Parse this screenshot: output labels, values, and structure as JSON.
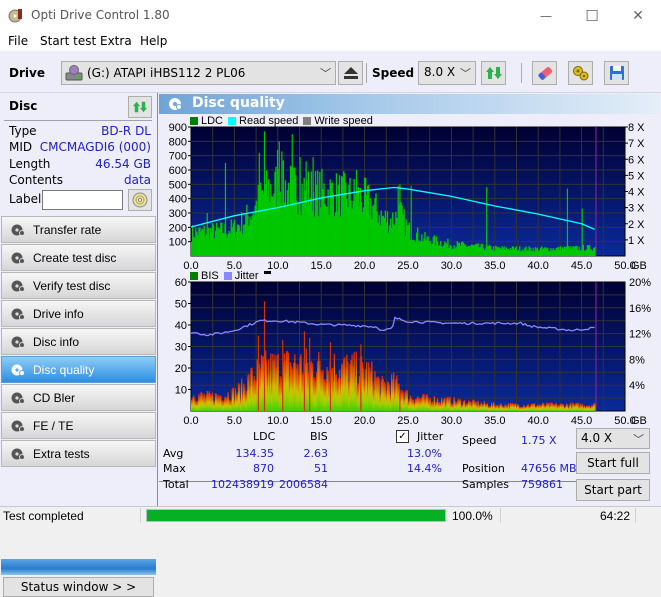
{
  "window": {
    "title": "Opti Drive Control 1.80",
    "controls": {
      "minimize": "—",
      "maximize": "☐",
      "close": "✕"
    }
  },
  "menu": [
    "File",
    "Start test",
    "Extra",
    "Help"
  ],
  "toolbar": {
    "drive_label": "Drive",
    "drive_value": "(G:)  ATAPI iHBS112   2 PL06",
    "speed_label": "Speed",
    "speed_value": "8.0 X",
    "icons": [
      "eject-icon",
      "refresh-icon",
      "erase-icon",
      "settings-icon",
      "save-icon"
    ]
  },
  "disc": {
    "header": "Disc",
    "rows": [
      {
        "label": "Type",
        "value": "BD-R DL"
      },
      {
        "label": "MID",
        "value": "CMCMAGDI6 (000)"
      },
      {
        "label": "Length",
        "value": "46.54 GB"
      },
      {
        "label": "Contents",
        "value": "data"
      }
    ],
    "label_field": {
      "label": "Label",
      "value": ""
    }
  },
  "nav": [
    {
      "label": "Transfer rate",
      "active": false
    },
    {
      "label": "Create test disc",
      "active": false
    },
    {
      "label": "Verify test disc",
      "active": false
    },
    {
      "label": "Drive info",
      "active": false
    },
    {
      "label": "Disc info",
      "active": false
    },
    {
      "label": "Disc quality",
      "active": true
    },
    {
      "label": "CD Bler",
      "active": false
    },
    {
      "label": "FE / TE",
      "active": false
    },
    {
      "label": "Extra tests",
      "active": false
    }
  ],
  "status_window_button": "Status window > >",
  "panel": {
    "title": "Disc quality",
    "colors": {
      "plot_bg_top": "#000033",
      "plot_bg_bottom": "#0a2a9a",
      "grid": "#333333",
      "ldc": "#00c800",
      "read_speed": "#00ffff",
      "jitter": "#8888ff",
      "end_marker": "#a020a0"
    }
  },
  "chart_data": [
    {
      "type": "bar",
      "title": "LDC / Read speed",
      "legend": [
        {
          "name": "LDC",
          "color": "#008000"
        },
        {
          "name": "Read speed",
          "color": "#00ffff"
        },
        {
          "name": "Write speed",
          "color": "#808080"
        }
      ],
      "legend_position": "top-left",
      "xlabel": "GB",
      "xlim": [
        0,
        50
      ],
      "x_ticks": [
        "0.0",
        "5.0",
        "10.0",
        "15.0",
        "20.0",
        "25.0",
        "30.0",
        "35.0",
        "40.0",
        "45.0",
        "50.0"
      ],
      "ylim_left": [
        0,
        900
      ],
      "y_ticks_left": [
        "100",
        "200",
        "300",
        "400",
        "500",
        "600",
        "700",
        "800",
        "900"
      ],
      "ylim_right": [
        0,
        8
      ],
      "y_ticks_right": [
        "1 X",
        "2 X",
        "3 X",
        "4 X",
        "5 X",
        "6 X",
        "7 X",
        "8 X"
      ],
      "grid": true,
      "end_marker_gb": 46.54,
      "ldc_profile": {
        "x": [
          0,
          2,
          4,
          5,
          6,
          7,
          8,
          9,
          10,
          12,
          14,
          16,
          18,
          20,
          21,
          22,
          23,
          24,
          25,
          27,
          30,
          35,
          40,
          44,
          46.5
        ],
        "y": [
          180,
          190,
          200,
          220,
          270,
          350,
          450,
          520,
          540,
          520,
          500,
          490,
          470,
          440,
          380,
          300,
          280,
          330,
          200,
          130,
          90,
          60,
          55,
          60,
          65
        ]
      },
      "ldc_spikes": [
        {
          "x": 3.9,
          "y": 650
        },
        {
          "x": 8.4,
          "y": 870
        },
        {
          "x": 7.8,
          "y": 720
        },
        {
          "x": 9.9,
          "y": 740
        },
        {
          "x": 10.1,
          "y": 800
        },
        {
          "x": 10.4,
          "y": 730
        },
        {
          "x": 11.6,
          "y": 850
        },
        {
          "x": 12.5,
          "y": 690
        },
        {
          "x": 13.2,
          "y": 660
        },
        {
          "x": 14.0,
          "y": 690
        },
        {
          "x": 19.0,
          "y": 600
        },
        {
          "x": 23.8,
          "y": 490
        },
        {
          "x": 24.0,
          "y": 500
        },
        {
          "x": 25.3,
          "y": 490
        },
        {
          "x": 34.0,
          "y": 480
        },
        {
          "x": 43.3,
          "y": 470
        },
        {
          "x": 45.0,
          "y": 330
        },
        {
          "x": 1.8,
          "y": 300
        }
      ],
      "read_speed": {
        "x": [
          0,
          5,
          10,
          15,
          20,
          23.4,
          25,
          30,
          35,
          40,
          45,
          46.5
        ],
        "y": [
          1.8,
          2.5,
          3.0,
          3.6,
          4.05,
          4.25,
          4.15,
          3.7,
          3.1,
          2.6,
          2.0,
          1.65
        ]
      }
    },
    {
      "type": "bar",
      "title": "BIS / Jitter",
      "legend": [
        {
          "name": "BIS",
          "color": "#008000"
        },
        {
          "name": "Jitter",
          "color": "#8888ff"
        }
      ],
      "legend_position": "top-left",
      "xlabel": "GB",
      "xlim": [
        0,
        50
      ],
      "x_ticks": [
        "0.0",
        "5.0",
        "10.0",
        "15.0",
        "20.0",
        "25.0",
        "30.0",
        "35.0",
        "40.0",
        "45.0",
        "50.0"
      ],
      "ylim_left": [
        0,
        60
      ],
      "y_ticks_left": [
        "10",
        "20",
        "30",
        "40",
        "50",
        "60"
      ],
      "ylim_right": [
        0,
        20
      ],
      "y_ticks_right": [
        "4%",
        "8%",
        "12%",
        "16%",
        "20%"
      ],
      "grid": true,
      "end_marker_gb": 46.54,
      "bis_profile": {
        "x": [
          0,
          2,
          4,
          5,
          6,
          7,
          8,
          10,
          12,
          14,
          16,
          18,
          20,
          21,
          22,
          23,
          24,
          25,
          27,
          30,
          35,
          40,
          45,
          46.5
        ],
        "y": [
          8,
          7,
          8,
          9,
          12,
          17,
          21,
          22,
          23,
          22,
          22,
          21,
          20,
          17,
          12,
          14,
          12,
          7,
          6,
          5,
          3,
          3,
          3,
          3
        ]
      },
      "bis_spikes": [
        {
          "x": 8.4,
          "y": 51
        },
        {
          "x": 7.7,
          "y": 35
        },
        {
          "x": 13.0,
          "y": 37
        },
        {
          "x": 13.6,
          "y": 34
        },
        {
          "x": 10.5,
          "y": 33
        },
        {
          "x": 16.0,
          "y": 32
        },
        {
          "x": 19.5,
          "y": 31
        },
        {
          "x": 24.0,
          "y": 10
        }
      ],
      "jitter": {
        "x": [
          0,
          2,
          4,
          5,
          6,
          8,
          10,
          12,
          15,
          18,
          20,
          21.5,
          22,
          23.2,
          23.5,
          25,
          30,
          35,
          38,
          39,
          40,
          44,
          46.5
        ],
        "y": [
          12.2,
          11.8,
          12.2,
          12.5,
          13.0,
          14.0,
          14.0,
          13.8,
          13.4,
          13.3,
          13.2,
          13.0,
          12.4,
          12.8,
          14.4,
          13.9,
          13.6,
          13.6,
          13.6,
          13.2,
          13.0,
          12.5,
          12.9
        ]
      }
    }
  ],
  "stats": {
    "columns": [
      "LDC",
      "BIS"
    ],
    "jitter_checkbox": {
      "label": "Jitter",
      "checked": true
    },
    "rows": [
      {
        "label": "Avg",
        "ldc": "134.35",
        "bis": "2.63",
        "jitter": "13.0%"
      },
      {
        "label": "Max",
        "ldc": "870",
        "bis": "51",
        "jitter": "14.4%"
      },
      {
        "label": "Total",
        "ldc": "102438919",
        "bis": "2006584",
        "jitter": ""
      }
    ],
    "info": [
      {
        "label": "Speed",
        "value": "1.75 X"
      },
      {
        "label": "Position",
        "value": "47656 MB"
      },
      {
        "label": "Samples",
        "value": "759861"
      }
    ],
    "speed_select": "4.0 X",
    "start_full": "Start full",
    "start_part": "Start part"
  },
  "statusbar": {
    "text": "Test completed",
    "progress": 1.0,
    "progress_text": "100.0%",
    "time": "64:22"
  }
}
